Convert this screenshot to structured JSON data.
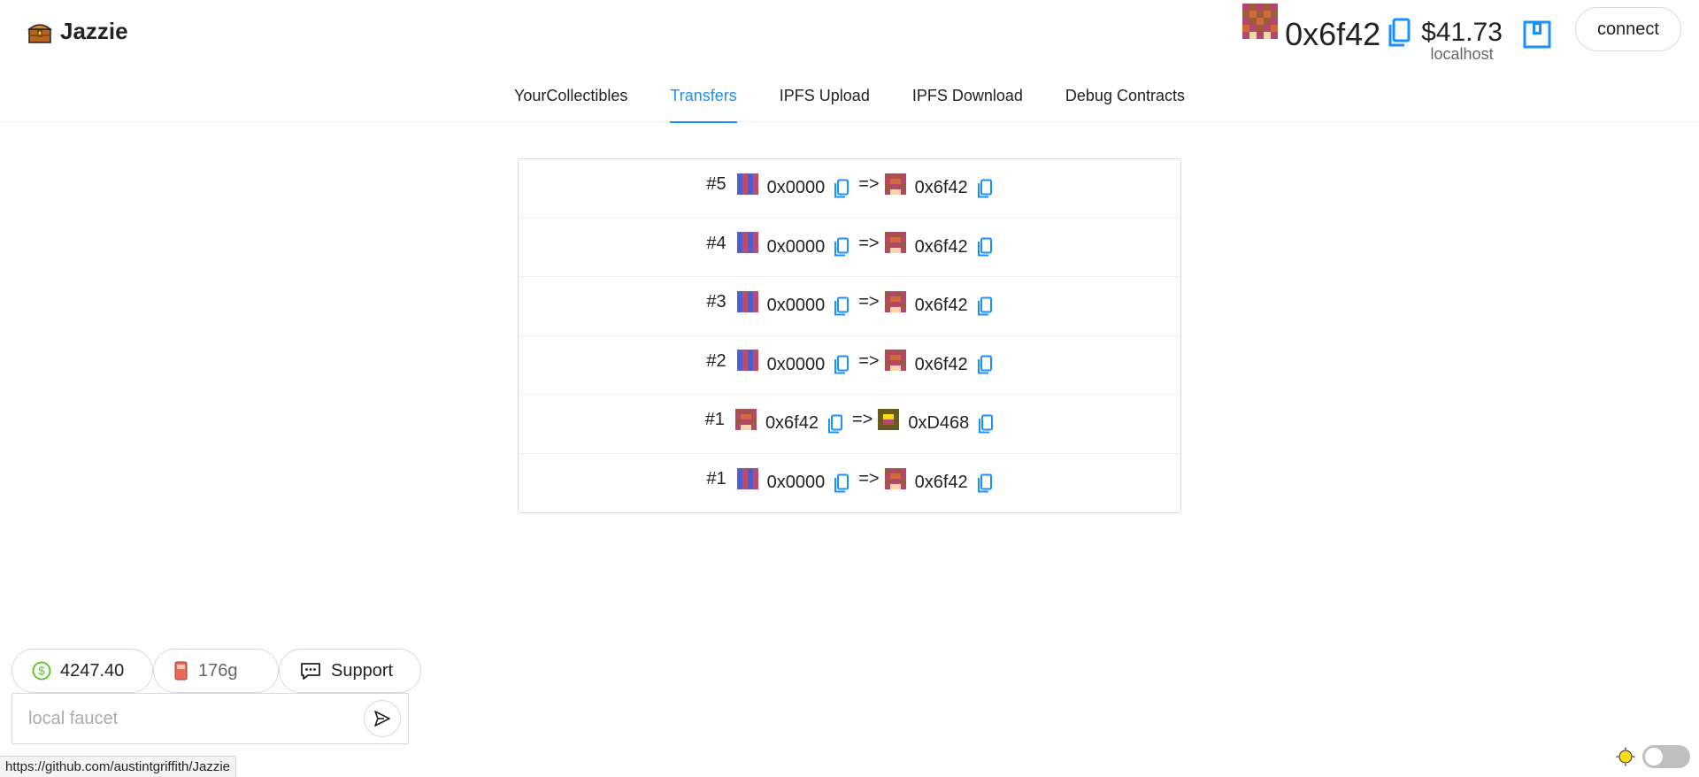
{
  "app": {
    "title": "Jazzie"
  },
  "account": {
    "address": "0x6f42",
    "balance": "$41.73",
    "network": "localhost",
    "connect_label": "connect"
  },
  "nav": {
    "items": [
      {
        "label": "YourCollectibles",
        "active": false
      },
      {
        "label": "Transfers",
        "active": true
      },
      {
        "label": "IPFS Upload",
        "active": false
      },
      {
        "label": "IPFS Download",
        "active": false
      },
      {
        "label": "Debug Contracts",
        "active": false
      }
    ]
  },
  "transfers": [
    {
      "id": "#5",
      "from": "0x0000",
      "from_blockie": "blue",
      "arrow": "=>",
      "to": "0x6f42",
      "to_blockie": "red"
    },
    {
      "id": "#4",
      "from": "0x0000",
      "from_blockie": "blue",
      "arrow": "=>",
      "to": "0x6f42",
      "to_blockie": "red"
    },
    {
      "id": "#3",
      "from": "0x0000",
      "from_blockie": "blue",
      "arrow": "=>",
      "to": "0x6f42",
      "to_blockie": "red"
    },
    {
      "id": "#2",
      "from": "0x0000",
      "from_blockie": "blue",
      "arrow": "=>",
      "to": "0x6f42",
      "to_blockie": "red"
    },
    {
      "id": "#1",
      "from": "0x6f42",
      "from_blockie": "red",
      "arrow": "=>",
      "to": "0xD468",
      "to_blockie": "olive"
    },
    {
      "id": "#1",
      "from": "0x0000",
      "from_blockie": "blue",
      "arrow": "=>",
      "to": "0x6f42",
      "to_blockie": "red"
    }
  ],
  "footer": {
    "price": "4247.40",
    "gas": "176g",
    "support_label": "Support",
    "faucet_placeholder": "local faucet",
    "status_url": "https://github.com/austintgriffith/Jazzie"
  },
  "colors": {
    "accent": "#1890ff",
    "price_icon": "#52c41a",
    "sun": "#fadb14"
  },
  "icons": {
    "brand": "treasure-chest-icon",
    "copy": "copy-icon",
    "wallet": "wallet-icon",
    "price": "dollar-circle-icon",
    "gas": "gas-pump-icon",
    "support": "chat-bubble-icon",
    "send": "send-icon",
    "theme": "sun-icon"
  }
}
